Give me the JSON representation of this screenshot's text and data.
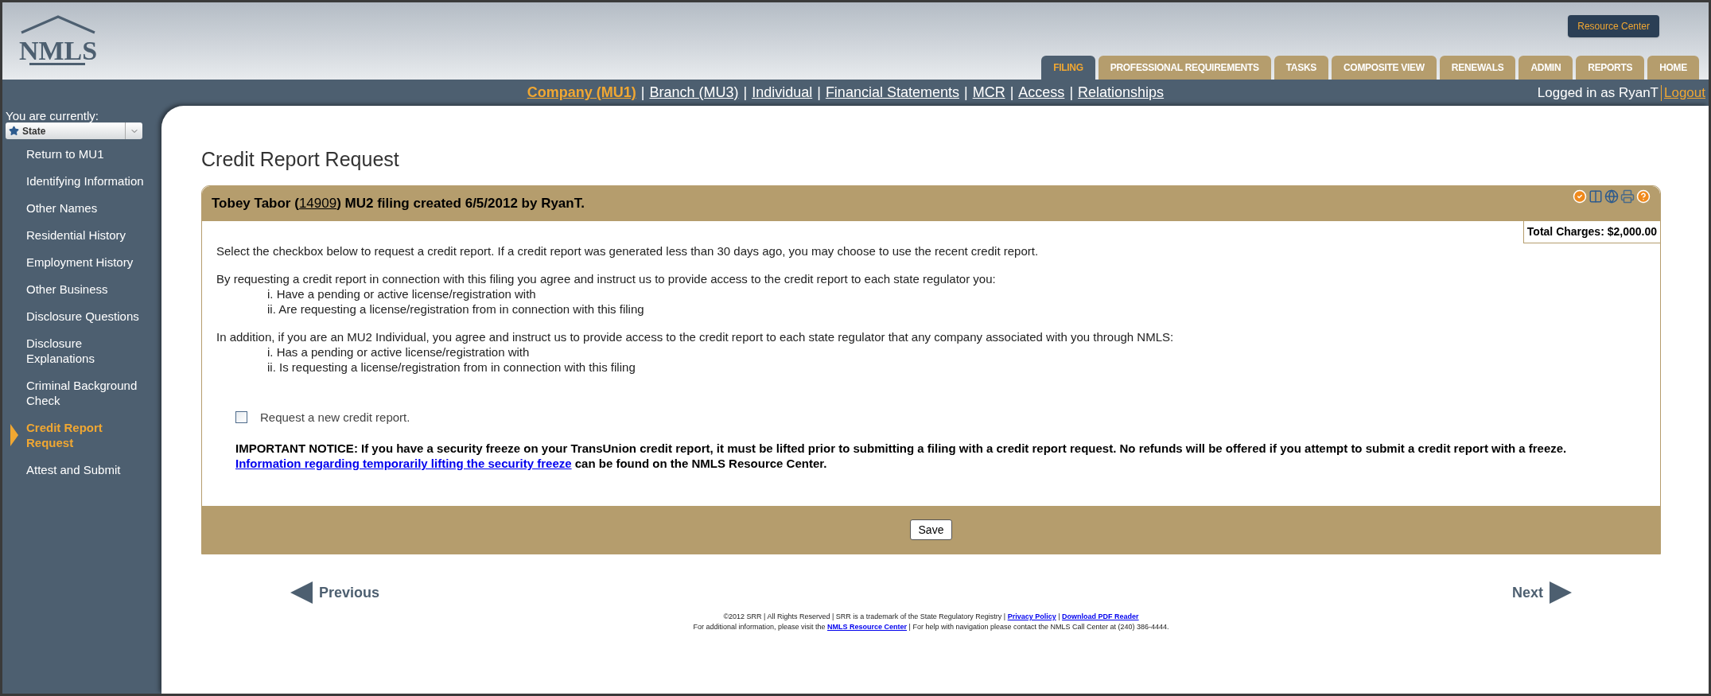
{
  "header": {
    "logo": "NMLS",
    "resource_button": "Resource Center",
    "tabs": [
      {
        "label": "FILING",
        "selected": true
      },
      {
        "label": "PROFESSIONAL REQUIREMENTS",
        "selected": false
      },
      {
        "label": "TASKS",
        "selected": false
      },
      {
        "label": "COMPOSITE VIEW",
        "selected": false
      },
      {
        "label": "RENEWALS",
        "selected": false
      },
      {
        "label": "ADMIN",
        "selected": false
      },
      {
        "label": "REPORTS",
        "selected": false
      },
      {
        "label": "HOME",
        "selected": false
      }
    ]
  },
  "nav": {
    "links": [
      {
        "label": "Company (MU1)",
        "selected": true
      },
      {
        "label": "Branch (MU3)",
        "selected": false
      },
      {
        "label": "Individual",
        "selected": false
      },
      {
        "label": "Financial Statements",
        "selected": false
      },
      {
        "label": "MCR",
        "selected": false
      },
      {
        "label": "Access",
        "selected": false
      },
      {
        "label": "Relationships",
        "selected": false
      }
    ],
    "separator": "|",
    "logged_in": "Logged in as RyanT",
    "logout": "Logout"
  },
  "sidebar": {
    "label": "You are currently:",
    "context": "State",
    "items": [
      {
        "label": "Return to MU1",
        "selected": false
      },
      {
        "label": "Identifying Information",
        "selected": false
      },
      {
        "label": "Other Names",
        "selected": false
      },
      {
        "label": "Residential History",
        "selected": false
      },
      {
        "label": "Employment History",
        "selected": false
      },
      {
        "label": "Other Business",
        "selected": false
      },
      {
        "label": "Disclosure Questions",
        "selected": false
      },
      {
        "label": "Disclosure Explanations",
        "selected": false
      },
      {
        "label": "Criminal Background Check",
        "selected": false
      },
      {
        "label": "Credit Report Request",
        "selected": true
      },
      {
        "label": "Attest and Submit",
        "selected": false
      }
    ]
  },
  "page_title": "Credit Report Request",
  "panel": {
    "title_before": "Tobey Tabor (",
    "title_link": "14909",
    "title_after": ") MU2 filing created 6/5/2012 by RyanT.",
    "total_charges": "Total Charges: $2,000.00",
    "intro": "Select the checkbox below to request a credit report. If a credit report was generated less than 30 days ago, you may choose to use the recent credit report.",
    "sections": [
      {
        "text": "By requesting a credit report in connection with this filing you agree and instruct us to provide access to the credit report to each state regulator you:",
        "items": [
          "i. Have a pending or active license/registration with",
          "ii. Are requesting a license/registration from in connection with this filing"
        ]
      },
      {
        "text": "In addition, if you are an MU2 Individual, you agree and instruct us to provide access to the credit report to each state regulator that any company associated with you through NMLS:",
        "items": [
          "i. Has a pending or active license/registration with",
          "ii. Is requesting a license/registration from in connection with this filing"
        ]
      }
    ],
    "checkbox": {
      "label": "Request a new credit report.",
      "checked": false
    },
    "notice": "IMPORTANT NOTICE: If you have a security freeze on your TransUnion credit report, it must be lifted prior to submitting a filing with a credit report request. No refunds will be offered if you attempt to submit a credit report with a freeze.",
    "notice_link": "Information regarding temporarily lifting the security freeze",
    "notice_after": "can be found on the NMLS Resource Center.",
    "save": "Save"
  },
  "pager": {
    "previous": "Previous",
    "next": "Next"
  },
  "footer": [
    [
      {
        "kind": "text",
        "text": "©2012 SRR | All Rights Reserved | SRR is a trademark of the State Regulatory Registry | "
      },
      {
        "kind": "link",
        "text": "Privacy Policy"
      },
      {
        "kind": "text",
        "text": " | "
      },
      {
        "kind": "link",
        "text": "Download PDF Reader"
      }
    ],
    [
      {
        "kind": "text",
        "text": "For additional information, please visit the "
      },
      {
        "kind": "link",
        "text": "NMLS Resource Center"
      },
      {
        "kind": "text",
        "text": " | For help with navigation please contact the NMLS Call Center at (240) 386-4444."
      }
    ]
  ]
}
